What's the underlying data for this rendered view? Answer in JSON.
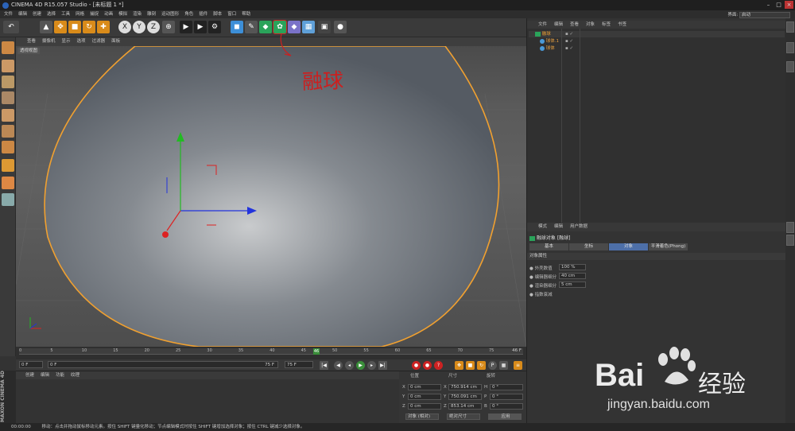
{
  "window": {
    "title": "CINEMA 4D R15.057 Studio - [未标题 1 *]"
  },
  "menubar": {
    "items": [
      "文件",
      "编辑",
      "创建",
      "选择",
      "工具",
      "网格",
      "捕捉",
      "动画",
      "模拟",
      "渲染",
      "雕刻",
      "运动图形",
      "角色",
      "插件",
      "脚本",
      "窗口",
      "帮助"
    ],
    "layout_label": "界面:",
    "layout_value": "启动"
  },
  "toolbar": {
    "axis_x": "X",
    "axis_y": "Y",
    "axis_z": "Z"
  },
  "viewport": {
    "menu": [
      "查看",
      "摄像机",
      "显示",
      "选项",
      "过滤器",
      "面板"
    ],
    "label": "透视视图"
  },
  "annotation": {
    "text": "融球"
  },
  "timeline": {
    "ticks": [
      "0",
      "5",
      "10",
      "15",
      "20",
      "25",
      "30",
      "35",
      "40",
      "45",
      "50",
      "55",
      "60",
      "65",
      "70",
      "75"
    ],
    "current_frame": "46",
    "end_label": "46 F"
  },
  "transport": {
    "start": "0 F",
    "current": "0 F",
    "end_a": "75 F",
    "end_b": "75 F"
  },
  "material": {
    "menu": [
      "创建",
      "编辑",
      "功能",
      "纹理"
    ]
  },
  "coords": {
    "headers": [
      "位置",
      "尺寸",
      "旋转"
    ],
    "rows": [
      {
        "axis": "X",
        "pos": "0 cm",
        "size_axis": "X",
        "size": "750.914 cm",
        "rot_axis": "H",
        "rot": "0 °"
      },
      {
        "axis": "Y",
        "pos": "0 cm",
        "size_axis": "Y",
        "size": "750.091 cm",
        "rot_axis": "P",
        "rot": "0 °"
      },
      {
        "axis": "Z",
        "pos": "0 cm",
        "size_axis": "Z",
        "size": "853.14 cm",
        "rot_axis": "B",
        "rot": "0 °"
      }
    ],
    "mode": "对象 (相对)",
    "size_mode": "绝对尺寸",
    "apply": "应用"
  },
  "status": {
    "time": "00:00:00",
    "text": "移动：点击并拖动鼠标移动元素。按住 SHIFT 键量化移动；节点编辑模式时按住 SHIFT 键增加选择对象；按住 CTRL 键减少选择对象。"
  },
  "objects": {
    "menu": [
      "文件",
      "编辑",
      "查看",
      "对象",
      "标签",
      "书签"
    ],
    "items": [
      {
        "name": "融球",
        "indent": 0,
        "color": "#f0a030"
      },
      {
        "name": "球体.1",
        "indent": 1,
        "color": "#e8a040"
      },
      {
        "name": "球体",
        "indent": 1,
        "color": "#e8a040"
      }
    ]
  },
  "attributes": {
    "menu": [
      "模式",
      "编辑",
      "用户数据"
    ],
    "object_title": "融球对象 [融球]",
    "tabs": [
      "基本",
      "坐标",
      "对象",
      "平滑着色(Phong)"
    ],
    "active_tab": "对象",
    "section": "对象属性",
    "props": [
      {
        "label": "外壳数值",
        "value": "100 %"
      },
      {
        "label": "编辑器细分",
        "value": "40 cm"
      },
      {
        "label": "渲染器细分",
        "value": "5 cm"
      },
      {
        "label": "指数衰减",
        "value": "..."
      }
    ]
  },
  "watermark": {
    "brand_a": "Bai",
    "brand_b": "du",
    "cn": "经验",
    "url": "jingyan.baidu.com"
  },
  "colors": {
    "accent": "#f0a030",
    "bg": "#333333",
    "active_tab": "#4d6fa8",
    "sphere": "#5b6168",
    "annotation": "#cc1f1f"
  }
}
